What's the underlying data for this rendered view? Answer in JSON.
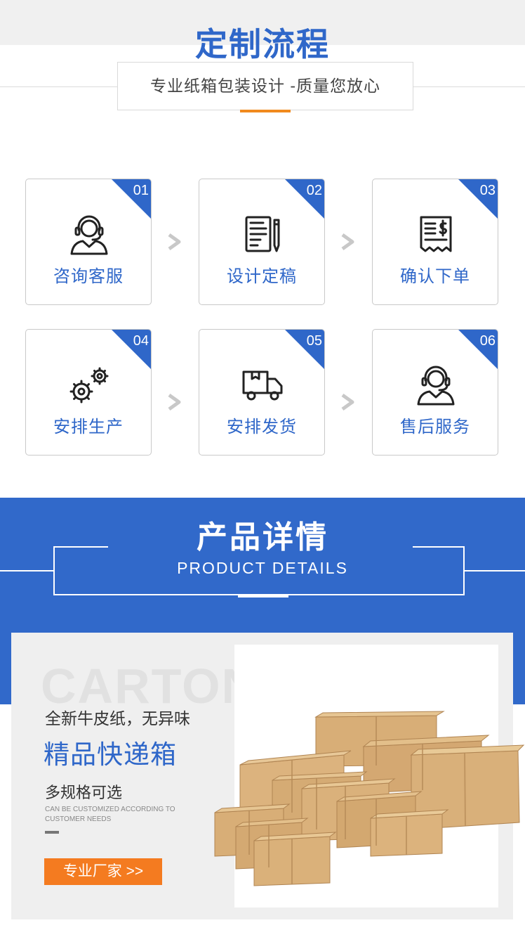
{
  "process": {
    "title": "定制流程",
    "subtitle": "专业纸箱包装设计 -质量您放心",
    "steps": [
      {
        "num": "01",
        "label": "咨询客服",
        "icon": "headset-agent-icon"
      },
      {
        "num": "02",
        "label": "设计定稿",
        "icon": "document-pen-icon"
      },
      {
        "num": "03",
        "label": "确认下单",
        "icon": "receipt-dollar-icon"
      },
      {
        "num": "04",
        "label": "安排生产",
        "icon": "gears-icon"
      },
      {
        "num": "05",
        "label": "安排发货",
        "icon": "delivery-truck-icon"
      },
      {
        "num": "06",
        "label": "售后服务",
        "icon": "headset-agent-icon"
      }
    ]
  },
  "details": {
    "title": "产品详情",
    "title_en": "PRODUCT DETAILS"
  },
  "product": {
    "bg_word": "CARTON",
    "line1": "全新牛皮纸，无异味",
    "line2": "精品快递箱",
    "line3": "多规格可选",
    "small1": "CAN BE CUSTOMIZED ACCORDING TO",
    "small2": "CUSTOMER NEEDS",
    "cta": "专业厂家 >>",
    "image": "cardboard-boxes-image"
  },
  "colors": {
    "brand_blue": "#2f67c9",
    "accent_orange": "#f18a1e",
    "kraft": "#d9b07a"
  }
}
